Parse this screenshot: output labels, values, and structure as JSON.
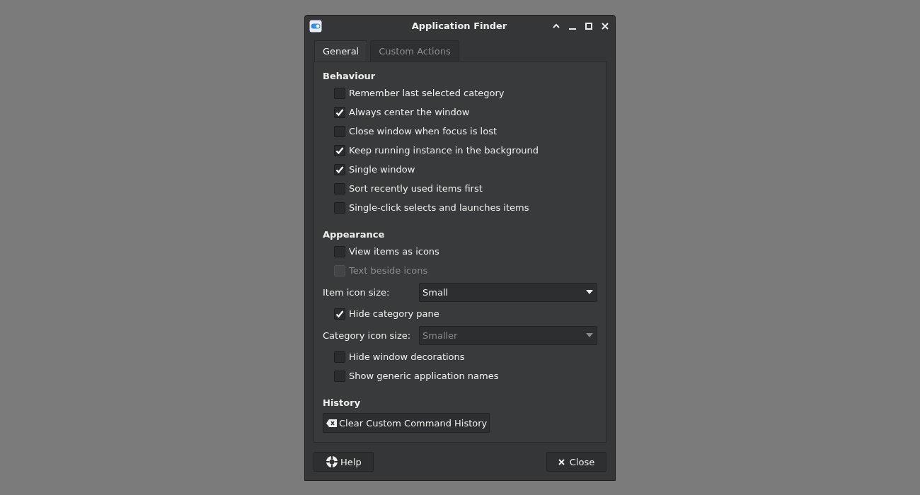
{
  "window": {
    "title": "Application Finder"
  },
  "tabs": [
    {
      "label": "General",
      "selected": true
    },
    {
      "label": "Custom Actions",
      "selected": false
    }
  ],
  "sections": [
    {
      "heading": "Behaviour",
      "items": [
        {
          "kind": "checkbox",
          "label": "Remember last selected category",
          "checked": false,
          "disabled": false
        },
        {
          "kind": "checkbox",
          "label": "Always center the window",
          "checked": true,
          "disabled": false
        },
        {
          "kind": "checkbox",
          "label": "Close window when focus is lost",
          "checked": false,
          "disabled": false
        },
        {
          "kind": "checkbox",
          "label": "Keep running instance in the background",
          "checked": true,
          "disabled": false
        },
        {
          "kind": "checkbox",
          "label": "Single window",
          "checked": true,
          "disabled": false
        },
        {
          "kind": "checkbox",
          "label": "Sort recently used items first",
          "checked": false,
          "disabled": false
        },
        {
          "kind": "checkbox",
          "label": "Single-click selects and launches items",
          "checked": false,
          "disabled": false
        }
      ]
    },
    {
      "heading": "Appearance",
      "items": [
        {
          "kind": "checkbox",
          "label": "View items as icons",
          "checked": false,
          "disabled": false
        },
        {
          "kind": "checkbox",
          "label": "Text beside icons",
          "checked": false,
          "disabled": true
        },
        {
          "kind": "combo",
          "label": "Item icon size:",
          "value": "Small",
          "disabled": false
        },
        {
          "kind": "checkbox",
          "label": "Hide category pane",
          "checked": true,
          "disabled": false
        },
        {
          "kind": "combo",
          "label": "Category icon size:",
          "value": "Smaller",
          "disabled": true
        },
        {
          "kind": "checkbox",
          "label": "Hide window decorations",
          "checked": false,
          "disabled": false
        },
        {
          "kind": "checkbox",
          "label": "Show generic application names",
          "checked": false,
          "disabled": false
        }
      ]
    },
    {
      "heading": "History",
      "items": [
        {
          "kind": "button",
          "label": "Clear Custom Command History"
        }
      ]
    }
  ],
  "footer": {
    "help": "Help",
    "close": "Close"
  }
}
